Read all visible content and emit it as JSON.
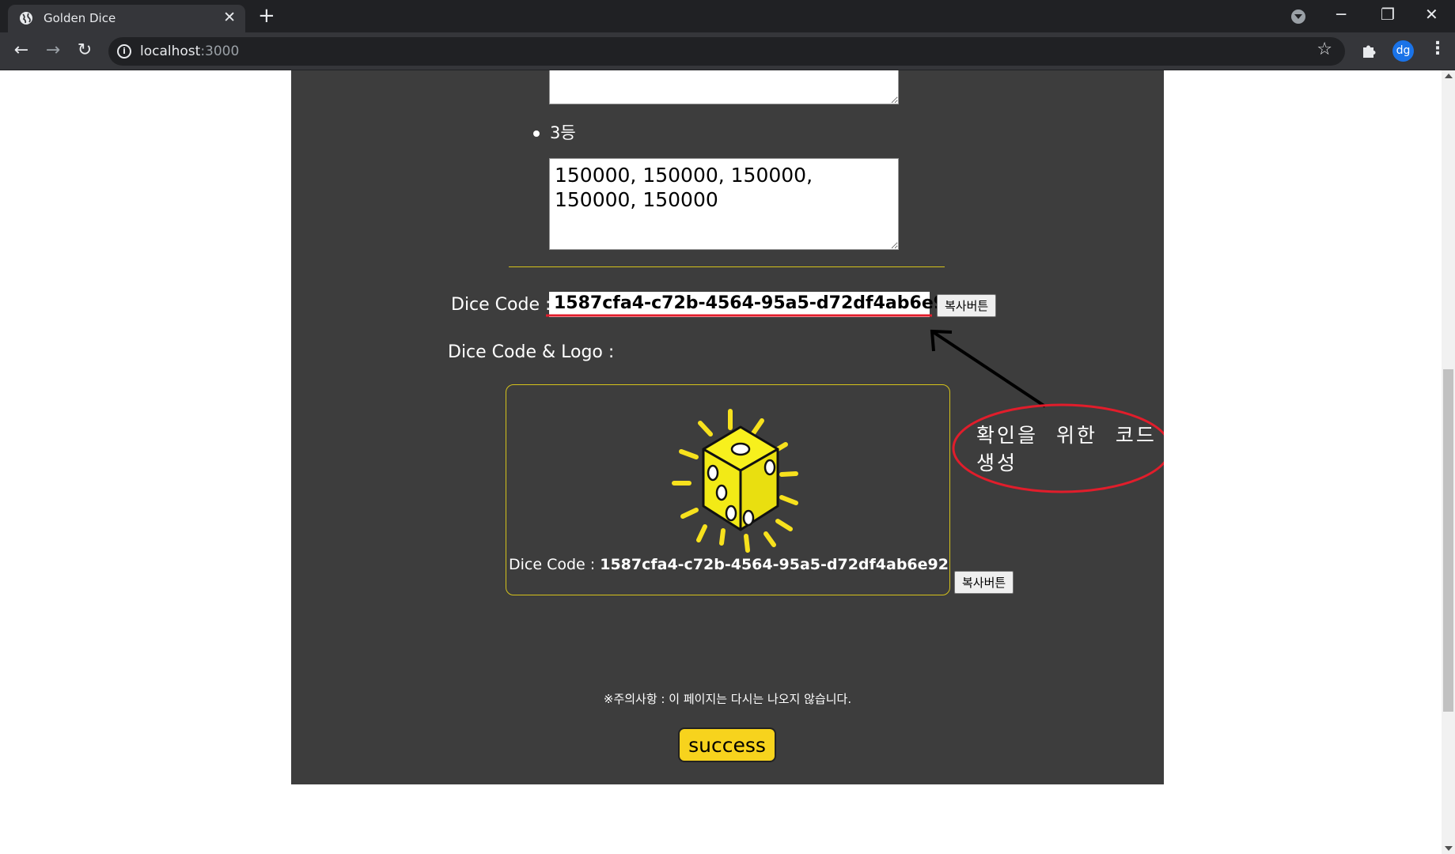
{
  "browser": {
    "tab_title": "Golden Dice",
    "url_host": "localhost",
    "url_port": ":3000",
    "profile_initials": "dg"
  },
  "icons": {
    "favicon": "globe-icon",
    "tab_close": "close-icon",
    "new_tab": "plus-icon",
    "back": "arrow-left-icon",
    "forward": "arrow-right-icon",
    "reload": "reload-icon",
    "site_info": "info-icon",
    "bookmark": "star-icon",
    "extensions": "puzzle-icon",
    "menu": "kebab-menu-icon"
  },
  "page": {
    "top_textarea_value": "",
    "third_prize": {
      "label": "3등",
      "value": "150000, 150000, 150000, 150000, 150000"
    },
    "dice_code_label": "Dice Code :",
    "dice_code_value": "1587cfa4-c72b-4564-95a5-d72df4ab6e92",
    "copy_button_label": "복사버튼",
    "dice_code_logo_label": "Dice Code & Logo :",
    "logo_caption_label": "Dice Code :",
    "logo_caption_value": "1587cfa4-c72b-4564-95a5-d72df4ab6e92",
    "copy_button_label_2": "복사버튼",
    "notice": "※주의사항 : 이 페이지는 다시는 나오지 않습니다.",
    "success_button_label": "success"
  },
  "annotation": {
    "text": "확인을 위한 코드 생성"
  },
  "colors": {
    "panel_bg": "#3d3d3d",
    "accent_yellow": "#f7d31d",
    "divider": "#d4c21b",
    "annotation_red": "#e11d2b"
  }
}
